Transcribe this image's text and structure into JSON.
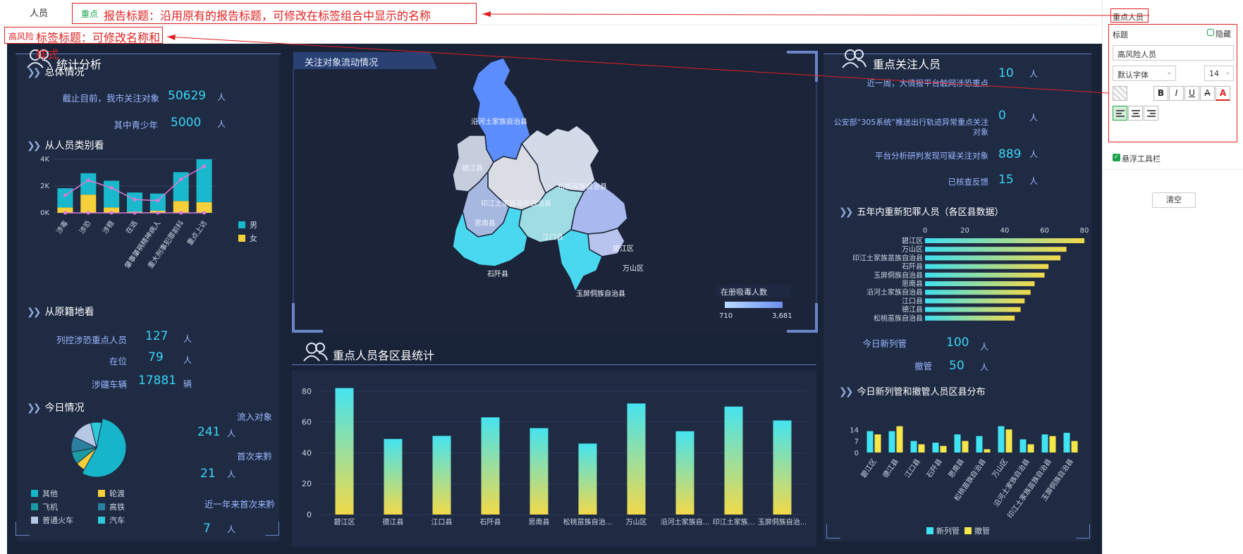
{
  "top": {
    "tab_label": "人员",
    "annotation1_tag": "重点",
    "annotation1_text": "报告标题：沿用原有的报告标题，可修改在标签组合中显示的名称",
    "annotation2_tag": "高风险",
    "annotation2_text": "标签标题：可修改名称和样式"
  },
  "colors": {
    "male": "#1ab8cc",
    "female": "#f5d03a",
    "accent": "#39d4f5",
    "label": "#9bb6ff",
    "annotation": "#e02020"
  },
  "left": {
    "title": "统计分析",
    "overall_title": "总体情况",
    "overall": [
      {
        "label": "截止目前，我市关注对象",
        "value": "50629",
        "unit": "人"
      },
      {
        "label": "其中青少年",
        "value": "5000",
        "unit": "人"
      }
    ],
    "category_title": "从人员类别看",
    "category_chart": {
      "type": "bar",
      "categories": [
        "涉毒",
        "涉恐",
        "涉稳",
        "在逃",
        "肇事肇祸精神病人",
        "重大刑事犯罪前科",
        "重点上访"
      ],
      "y_ticks": [
        "4K",
        "2K",
        "0K"
      ],
      "series": [
        {
          "name": "男",
          "values": [
            1800,
            2000,
            2500,
            1800,
            1600,
            2700,
            4000
          ]
        },
        {
          "name": "女",
          "values": [
            500,
            1700,
            500,
            100,
            200,
            1100,
            1000
          ]
        }
      ],
      "ylim": [
        0,
        5000
      ],
      "legend": [
        "男",
        "女"
      ]
    },
    "origin_title": "从原籍地看",
    "origin": [
      {
        "label": "列控涉恐重点人员",
        "value": "127",
        "unit": "人"
      },
      {
        "label": "在位",
        "value": "79",
        "unit": "人"
      },
      {
        "label": "涉疆车辆",
        "value": "17881",
        "unit": "辆"
      }
    ],
    "today_title": "今日情况",
    "today_pie": {
      "type": "pie",
      "slices": [
        {
          "name": "其他",
          "value": 55,
          "color": "#17b5c9"
        },
        {
          "name": "轮渡",
          "value": 6,
          "color": "#f5d03a"
        },
        {
          "name": "飞机",
          "value": 8,
          "color": "#1c9aa3"
        },
        {
          "name": "高铁",
          "value": 10,
          "color": "#2c7f9e"
        },
        {
          "name": "普通火车",
          "value": 14,
          "color": "#b7c7e6"
        },
        {
          "name": "汽车",
          "value": 7,
          "color": "#2ec9d9"
        }
      ]
    },
    "today_stats": [
      {
        "label": "流入对象",
        "value": "241",
        "unit": "人"
      },
      {
        "label": "首次来黔",
        "value": "21",
        "unit": "人"
      },
      {
        "label": "近一年来首次来黔",
        "value": "7",
        "unit": "人"
      }
    ]
  },
  "center": {
    "map_title": "关注对象流动情况",
    "map_regions": [
      "沿河土家族自治县",
      "德江县",
      "松桃苗族自治县",
      "印江土家族苗族自治县",
      "思南县",
      "江口县",
      "碧江区",
      "石阡县",
      "万山区",
      "玉屏侗族自治县"
    ],
    "map_legend_title": "在册吸毒人数",
    "map_legend_min": "710",
    "map_legend_max": "3,681",
    "bar_title": "重点人员各区县统计",
    "bar_chart": {
      "type": "bar",
      "categories": [
        "碧江区",
        "德江县",
        "江口县",
        "石阡县",
        "思南县",
        "松桃苗族自治...",
        "万山区",
        "沿河土家族自...",
        "印江土家族...",
        "玉屏侗族自治..."
      ],
      "values": [
        82,
        49,
        51,
        63,
        56,
        46,
        72,
        54,
        70,
        61
      ],
      "y_ticks": [
        "80",
        "60",
        "40",
        "20",
        "0"
      ],
      "ylim": [
        0,
        85
      ]
    }
  },
  "right": {
    "title": "重点关注人员",
    "stats": [
      {
        "label": "近一周，大情报平台触网涉恐重点",
        "value": "10",
        "unit": "人"
      },
      {
        "label": "公安部“305系统”推送出行轨迹异常重点关注对象",
        "value": "0",
        "unit": "人"
      },
      {
        "label": "平台分析研判发现可疑关注对象",
        "value": "889",
        "unit": "人"
      },
      {
        "label": "已核查反馈",
        "value": "15",
        "unit": "人"
      }
    ],
    "hbar_title": "五年内重新犯罪人员（各区县数据）",
    "hbar_chart": {
      "type": "bar",
      "x_ticks": [
        "0",
        "20",
        "40",
        "60",
        "80"
      ],
      "xlim": [
        0,
        80
      ],
      "categories": [
        "碧江区",
        "万山区",
        "印江土家族苗族自治县",
        "石阡县",
        "玉屏侗族自治县",
        "思南县",
        "沿河土家族自治县",
        "江口县",
        "德江县",
        "松桃苗族自治县"
      ],
      "values": [
        80,
        71,
        68,
        62,
        60,
        55,
        53,
        50,
        48,
        45
      ]
    },
    "today_stats": [
      {
        "label": "今日新列管",
        "value": "100",
        "unit": "人"
      },
      {
        "label": "撤管",
        "value": "50",
        "unit": "人"
      }
    ],
    "dist_title": "今日新列管和撤管人员区县分布",
    "dist_chart": {
      "type": "bar",
      "categories": [
        "碧江区",
        "德江县",
        "江口县",
        "石阡县",
        "思南县",
        "松桃苗族自治县",
        "万山区",
        "沿河土家族自治县",
        "印江土家族苗族自治县",
        "玉屏侗族自治县"
      ],
      "y_ticks": [
        "14",
        "7",
        "0"
      ],
      "ylim": [
        0,
        18
      ],
      "series": [
        {
          "name": "新列管",
          "values": [
            13,
            13,
            7,
            6,
            11,
            10,
            16,
            8,
            11,
            12
          ]
        },
        {
          "name": "撤管",
          "values": [
            11,
            16,
            5,
            4,
            7,
            2,
            14,
            5,
            10,
            7
          ]
        }
      ],
      "legend": [
        "新列管",
        "撤管"
      ]
    }
  },
  "props": {
    "tab_label": "重点人员",
    "title_label": "标题",
    "hide_label": "隐藏",
    "title_value": "高风险人员",
    "font_value": "默认字体",
    "size_value": "14",
    "bold": "B",
    "italic": "I",
    "underline": "U",
    "strike": "A",
    "color": "A",
    "float_toolbar_label": "悬浮工具栏",
    "clear_label": "清空"
  }
}
